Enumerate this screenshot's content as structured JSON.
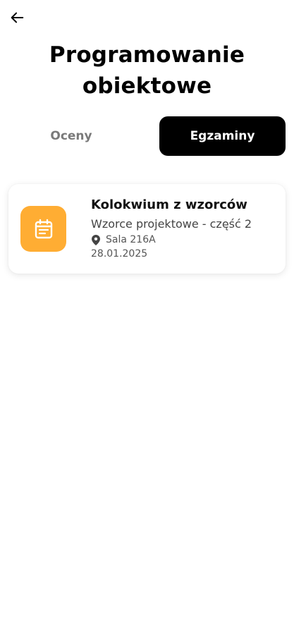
{
  "header": {
    "back_icon": "arrow-left-icon",
    "title_line1": "Programowanie",
    "title_line2": "obiektowe"
  },
  "tabs": [
    {
      "label": "Oceny",
      "active": false
    },
    {
      "label": "Egzaminy",
      "active": true
    }
  ],
  "exams": [
    {
      "icon": "calendar-note-icon",
      "title": "Kolokwium z wzorców",
      "subtitle": "Wzorce projektowe - część 2",
      "location_icon": "map-pin-icon",
      "location": "Sala 216A",
      "date": "28.01.2025"
    }
  ],
  "colors": {
    "accent": "#ffad33",
    "active_tab_bg": "#000000",
    "active_tab_text": "#ffffff",
    "inactive_tab_text": "#7a7a7a"
  }
}
